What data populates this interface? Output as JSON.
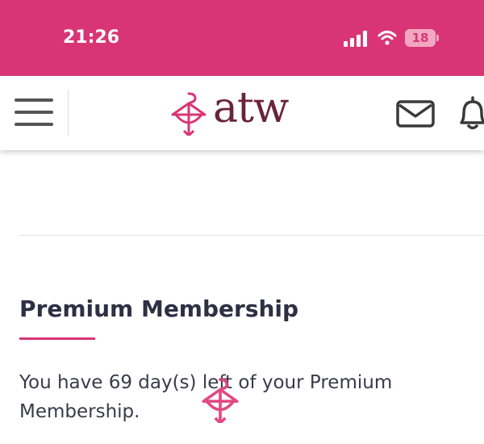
{
  "status_bar": {
    "time": "21:26",
    "battery_level": "18",
    "icons": [
      "signal-icon",
      "wifi-icon",
      "battery-icon"
    ]
  },
  "header": {
    "logo_text": "atw",
    "icons": [
      "menu-icon",
      "logo-icon",
      "mail-icon",
      "bell-icon"
    ]
  },
  "membership": {
    "title": "Premium Membership",
    "message": "You have 69 day(s) left of your Premium Membership."
  },
  "colors": {
    "brand_pink": "#d93576",
    "logo_text": "#6a2338",
    "title_text": "#2f2f44"
  }
}
